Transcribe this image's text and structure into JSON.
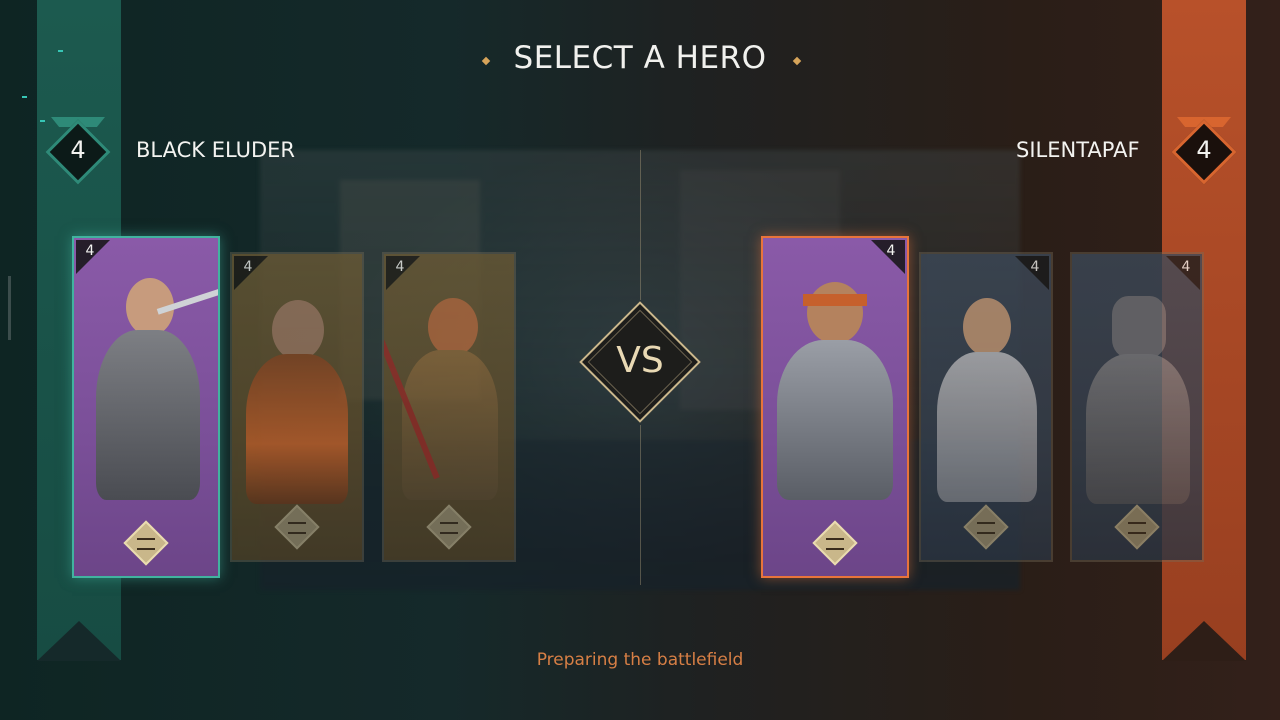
{
  "header": {
    "title": "SELECT A HERO"
  },
  "players": {
    "left": {
      "name": "BLACK ELUDER",
      "rank": "4",
      "color": "#1c5a4f"
    },
    "right": {
      "name": "SILENTAPAF",
      "rank": "4",
      "color": "#b8512a"
    }
  },
  "left_team": [
    {
      "level": "4",
      "state": "selected",
      "portrait": "swordswoman-hero"
    },
    {
      "level": "4",
      "state": "unselected",
      "portrait": "fire-mage-hero"
    },
    {
      "level": "4",
      "state": "unselected",
      "portrait": "monkey-king-hero"
    }
  ],
  "right_team": [
    {
      "level": "4",
      "state": "selected",
      "portrait": "headband-warrior-hero"
    },
    {
      "level": "4",
      "state": "unselected",
      "portrait": "blonde-knight-hero"
    },
    {
      "level": "4",
      "state": "unselected",
      "portrait": "helmeted-knight-hero"
    }
  ],
  "versus": {
    "label": "VS"
  },
  "status": {
    "text": "Preparing the battlefield"
  },
  "colors": {
    "accent_gold": "#cbb88d",
    "status_orange": "#d77f45",
    "team_left": "#41b39f",
    "team_right": "#e8743b"
  }
}
